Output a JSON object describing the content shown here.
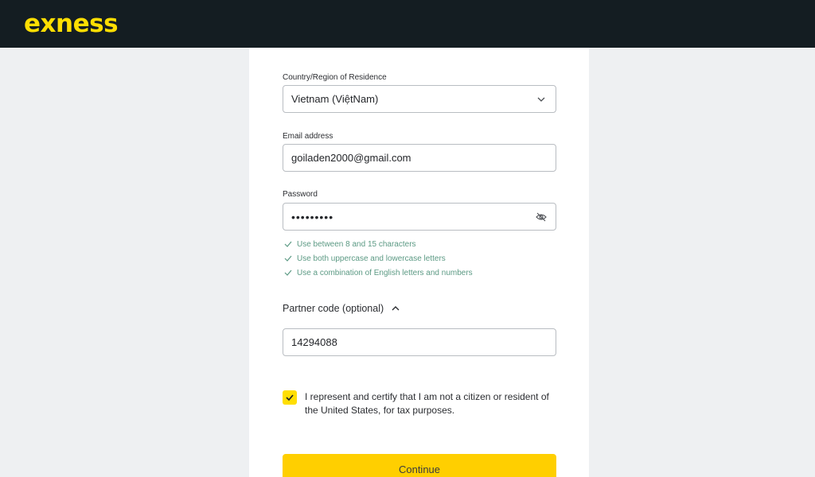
{
  "header": {
    "logo_text": "exness"
  },
  "form": {
    "country": {
      "label": "Country/Region of Residence",
      "value": "Vietnam (ViệtNam)"
    },
    "email": {
      "label": "Email address",
      "value": "goiladen2000@gmail.com"
    },
    "password": {
      "label": "Password",
      "value": "•••••••••"
    },
    "rules": [
      "Use between 8 and 15 characters",
      "Use both uppercase and lowercase letters",
      "Use a combination of English letters and numbers"
    ],
    "partner": {
      "label": "Partner code (optional)",
      "value": "14294088"
    },
    "certify": {
      "checked": true,
      "text": "I represent and certify that I am not a citizen or resident of the United States, for tax purposes."
    },
    "continue_label": "Continue"
  },
  "colors": {
    "brand": "#ffde02",
    "button": "#ffcf00",
    "rule_ok": "#5c9a84",
    "topbar": "#141d22"
  }
}
